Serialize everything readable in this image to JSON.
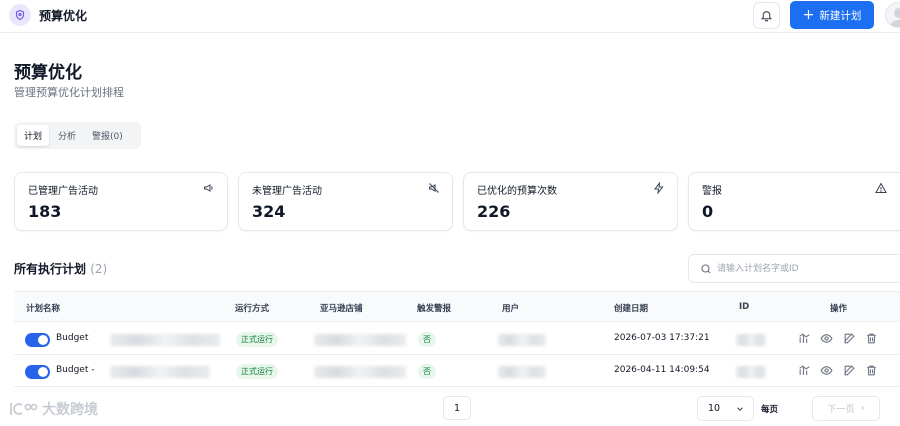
{
  "header": {
    "app_title": "预算优化",
    "new_plan_label": "新建计划"
  },
  "page": {
    "title": "预算优化",
    "subtitle": "管理预算优化计划排程"
  },
  "tabs": [
    {
      "label": "计划",
      "active": true
    },
    {
      "label": "分析",
      "active": false
    },
    {
      "label": "警报(0)",
      "active": false
    }
  ],
  "stats": [
    {
      "label": "已管理广告活动",
      "value": "183",
      "icon": "megaphone-icon"
    },
    {
      "label": "未管理广告活动",
      "value": "324",
      "icon": "megaphone-off-icon"
    },
    {
      "label": "已优化的预算次数",
      "value": "226",
      "icon": "zap-icon"
    },
    {
      "label": "警报",
      "value": "0",
      "icon": "alert-triangle-icon"
    }
  ],
  "section": {
    "title": "所有执行计划",
    "count": "(2)",
    "search_placeholder": "请输入计划名字或ID"
  },
  "table": {
    "columns": [
      "计划名称",
      "运行方式",
      "亚马逊店铺",
      "触发警报",
      "用户",
      "创建日期",
      "ID",
      "操作"
    ],
    "rows": [
      {
        "enabled": true,
        "name": "Budget",
        "run_mode": "正式运行",
        "alert": "否",
        "created": "2026-07-03 17:37:21"
      },
      {
        "enabled": true,
        "name": "Budget -",
        "run_mode": "正式运行",
        "alert": "否",
        "created": "2026-04-11 14:09:54"
      }
    ]
  },
  "pagination": {
    "current_page": "1",
    "page_size": "10",
    "per_page_label": "每页",
    "next_label": "下一页"
  },
  "watermark": {
    "text": "大数跨境"
  },
  "colors": {
    "primary": "#1d6ff2",
    "success_bg": "#e7f7ec",
    "success_text": "#15803d"
  }
}
